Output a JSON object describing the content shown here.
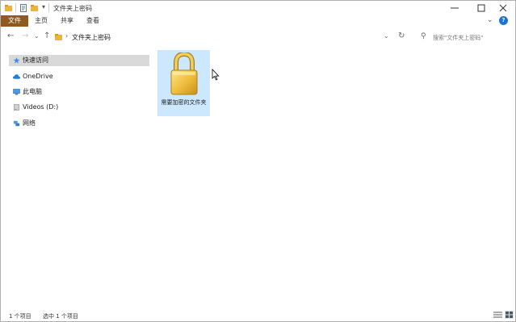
{
  "window": {
    "title": "文件夹上密码"
  },
  "ribbon": {
    "tabs": [
      "文件",
      "主页",
      "共享",
      "查看"
    ]
  },
  "address": {
    "path": [
      "文件夹上密码"
    ],
    "search_placeholder": "搜索\"文件夹上密码\""
  },
  "nav_pane": {
    "items": [
      {
        "label": "快速访问",
        "icon": "star-icon"
      },
      {
        "label": "OneDrive",
        "icon": "cloud-icon"
      },
      {
        "label": "此电脑",
        "icon": "computer-icon"
      },
      {
        "label": "Videos (D:)",
        "icon": "drive-icon"
      },
      {
        "label": "网络",
        "icon": "network-icon"
      }
    ]
  },
  "content": {
    "items": [
      {
        "name": "需要加密的文件夹",
        "icon": "padlock-icon",
        "selected": true
      }
    ]
  },
  "status": {
    "item_count": "1 个项目",
    "selection": "选中 1 个项目"
  },
  "colors": {
    "file_tab": "#8e5a1e",
    "selection": "#cce8ff",
    "nav_selected": "#d9d9d9",
    "accent": "#0078d7"
  }
}
